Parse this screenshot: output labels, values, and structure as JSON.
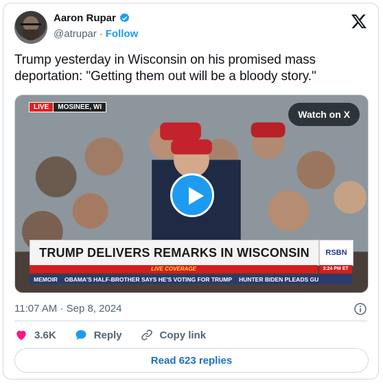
{
  "author": {
    "name": "Aaron Rupar",
    "handle": "@atrupar",
    "separator": "·",
    "follow_label": "Follow"
  },
  "tweet": {
    "text": "Trump yesterday in Wisconsin on his promised mass deportation: \"Getting them out will be a bloody story.\""
  },
  "media": {
    "live_label": "LIVE",
    "location": "MOSINEE, WI",
    "watch_label": "Watch on X",
    "headline": "TRUMP DELIVERS REMARKS IN WISCONSIN",
    "network": "RSBN",
    "coverage_label": "LIVE COVERAGE",
    "time": "3:24 PM ET",
    "ticker": [
      "MEMOIR",
      "OBAMA'S HALF-BROTHER SAYS HE'S VOTING FOR TRUMP",
      "HUNTER BIDEN PLEADS GU"
    ]
  },
  "meta": {
    "timestamp": "11:07 AM · Sep 8, 2024"
  },
  "actions": {
    "likes": "3.6K",
    "reply_label": "Reply",
    "copy_label": "Copy link"
  },
  "replies_button": "Read 623 replies",
  "colors": {
    "accent": "#1d9bf0",
    "like": "#f91880",
    "muted": "#536471"
  }
}
